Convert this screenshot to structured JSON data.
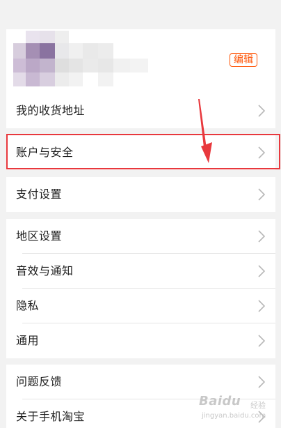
{
  "profile": {
    "edit_label": "编辑"
  },
  "settings_rows": {
    "address": "我的收货地址",
    "account_security": "账户与安全",
    "payment": "支付设置",
    "region": "地区设置",
    "sound_notification": "音效与通知",
    "privacy": "隐私",
    "general": "通用",
    "feedback": "问题反馈",
    "about": "关于手机淘宝"
  },
  "watermark": {
    "brand": "Baidu",
    "sub": "经验",
    "url": "jingyan.baidu.com"
  },
  "colors": {
    "accent": "#ff5000",
    "highlight": "#e8383d",
    "background": "#f2f2f2"
  },
  "icons": {
    "chevron": "chevron-right-icon",
    "annotation_arrow": "annotation-arrow-icon"
  }
}
